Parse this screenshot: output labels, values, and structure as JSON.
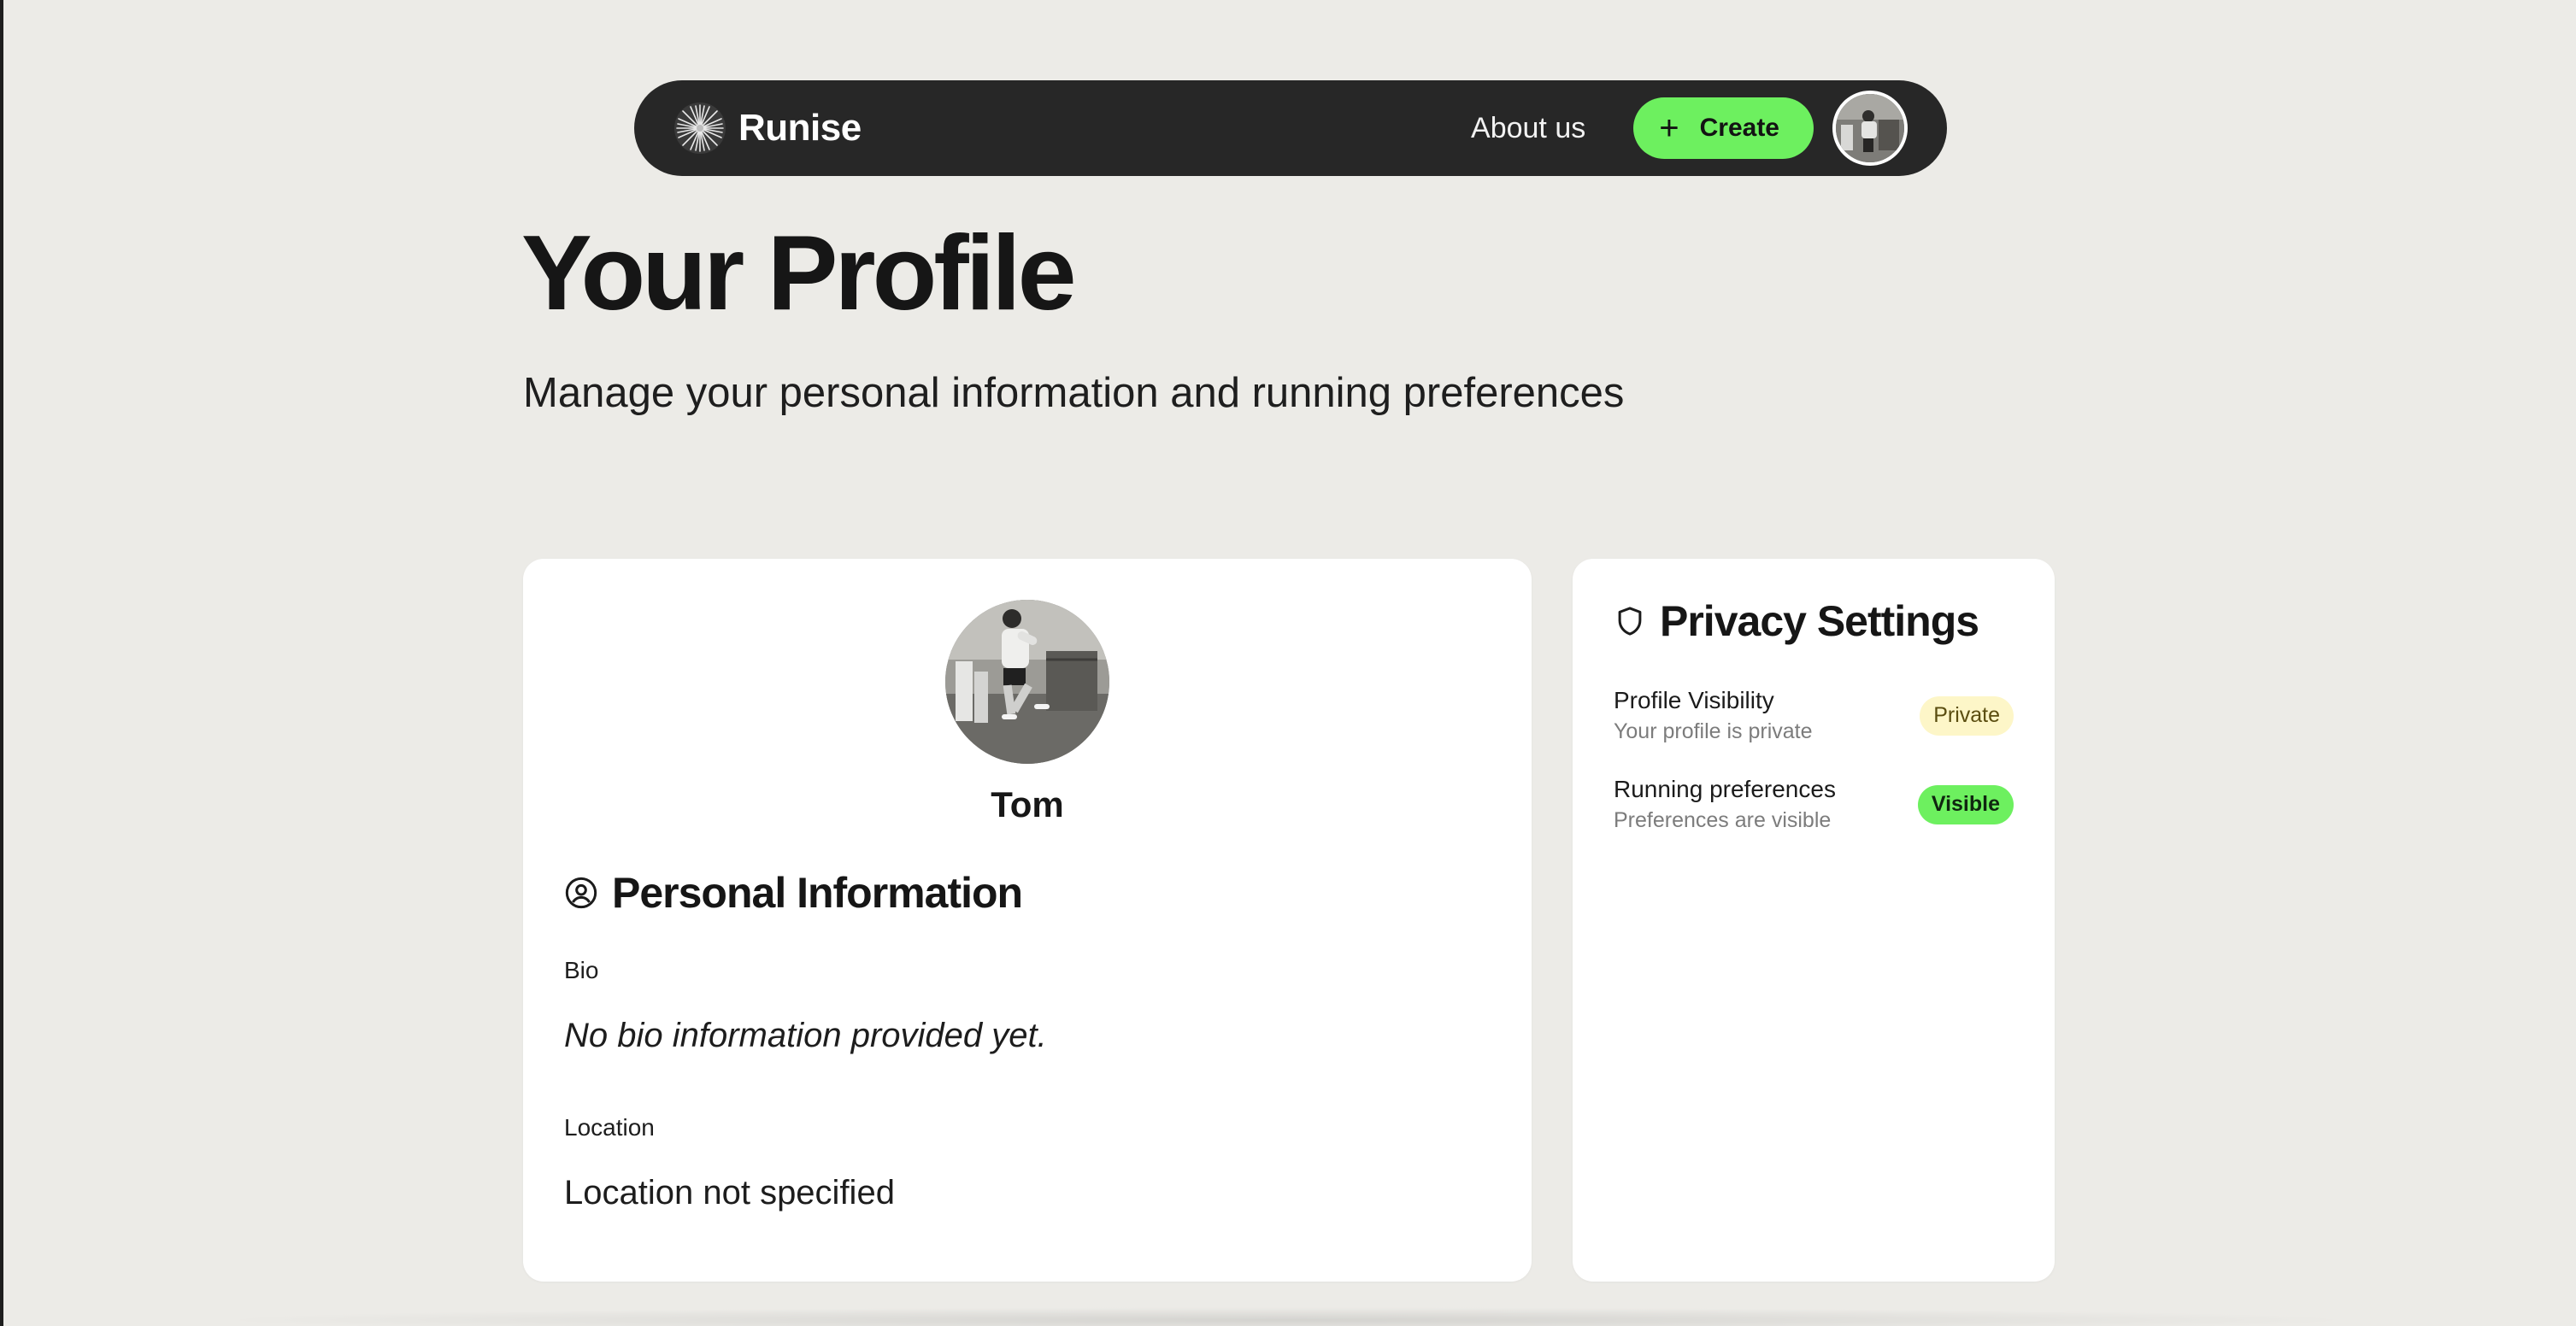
{
  "nav": {
    "brand": "Runise",
    "about_label": "About us",
    "create_label": "Create"
  },
  "header": {
    "title": "Your Profile",
    "subtitle": "Manage your personal information and running preferences"
  },
  "profile": {
    "name": "Tom",
    "section_title": "Personal Information",
    "bio_label": "Bio",
    "bio_value": "No bio information provided yet.",
    "location_label": "Location",
    "location_value": "Location not specified"
  },
  "privacy": {
    "section_title": "Privacy Settings",
    "items": [
      {
        "title": "Profile Visibility",
        "description": "Your profile is private",
        "badge": "Private"
      },
      {
        "title": "Running preferences",
        "description": "Preferences are visible",
        "badge": "Visible"
      }
    ]
  },
  "icons": {
    "brand": "starburst-logo-icon",
    "create": "plus-icon",
    "personal": "user-circle-icon",
    "privacy": "shield-icon"
  },
  "colors": {
    "background": "#ecebe7",
    "nav_background": "#272727",
    "accent_green": "#6df05f",
    "private_badge_bg": "#fdf6c8",
    "card_background": "#ffffff"
  }
}
